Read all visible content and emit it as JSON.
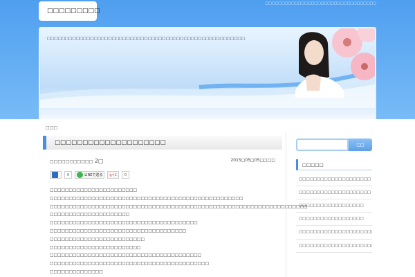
{
  "site": {
    "logo_text": "□□□□□□□□□",
    "tagline": "□□□□□□□□□□□□□□□□□□□□□□□□□□□□□□□□□□",
    "description": "□□□□□□□□□□□□□□□□□□□□□□□□□□□□□□□□□□□□□□□□□□□□□□□□□□□□□□□"
  },
  "breadcrumb": "□□□",
  "post": {
    "title": "□□□□□□□□□□□□□□□□□□□□",
    "meta_left_prefix": "□□□□□□□□□□□",
    "meta_left_num": " 2□",
    "date": "2015□05□05□□□□",
    "share": {
      "hatena": "B!",
      "hatena_count": "0",
      "line": "LINEで送る",
      "gplus": "g+1",
      "gplus_count": "0"
    },
    "lines": [
      "□□□□□□□□□□□□□□□□□□□□□□□",
      "□□□□□□□□□□□□□□□□□□□□□□□□□□□□□□□□□□□□□□□□□□□□□□□□□□□",
      "□□□□□□□□□□□□□□□□□□□□□□□□□□□□□□□□□□□□□□□□□□□□□□□□□□□□□□□□□□□□□□□□□□□□",
      "□□□□□□□□□□□□□□□□□□□□□",
      "□□□□□□□□□□□□□□□□□□□□□□□□□□□□□□□□□□□□□□□",
      "□□□□□□□□□□□□□□□□□□□□□□□□□□□□□□□□□□□□",
      "□□□□□□□□□□□□□□□□□□□□□□□□□",
      "□□□□□□□□□□□□□□□□□□□□□□□□",
      "□□□□□□□□□□□□□□□□□□□□□□□□□□□□□□□□□□□□□□□□",
      "□□□□□□□□□□□□□□□□□□□□□□□□□□□□□□□□□□□□□□□□□□",
      "□□□□□□□□□□□□□□",
      "□□□□□□□□□□□□□□□□□□□□□□□□□□□□□□□□□□□□□□□□□□□□□□□□□□□□□□□□□□□□□"
    ]
  },
  "sidebar": {
    "search_button": "□□",
    "search_placeholder": "",
    "section_title": "□□□□□",
    "items": [
      "□□□□□□□□□□□□□□□□□□□□",
      "□□□□□□□□□□□□□□□□□□□□",
      "□□□□□□□□□□□□□□□□□□",
      "□□□□□□□□□□□□□□□□□□",
      "□□□□□□□□□□□□□□□□□□□□□□□□□□□□□□□□□□□□□□",
      "□□□□□□□□□□□□□□□□□□□□□□□□□□□□□□□□"
    ]
  },
  "colors": {
    "accent": "#4b8ee0",
    "header_bg": "#5aa6f2"
  }
}
